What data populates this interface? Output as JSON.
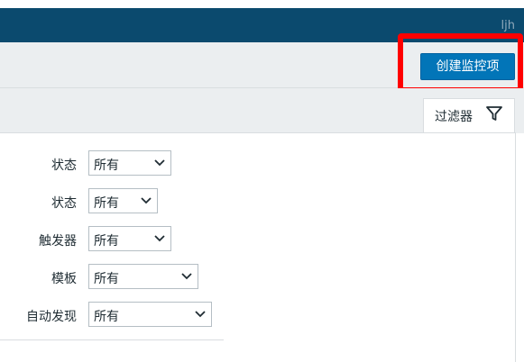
{
  "topbar": {
    "user": "ljh"
  },
  "header": {
    "create_button": "创建监控项"
  },
  "filter": {
    "tab_label": "过滤器",
    "rows": [
      {
        "label": "状态",
        "value": "所有"
      },
      {
        "label": "状态",
        "value": "所有"
      },
      {
        "label": "触发器",
        "value": "所有"
      },
      {
        "label": "模板",
        "value": "所有"
      },
      {
        "label": "自动发现",
        "value": "所有"
      }
    ]
  },
  "colors": {
    "topbar": "#0b4a6e",
    "primary_button": "#0275b8",
    "highlight": "#ff0000"
  }
}
